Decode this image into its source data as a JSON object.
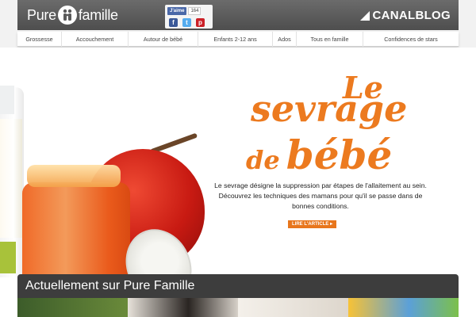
{
  "header": {
    "logo_left": "Pure",
    "logo_right": "famille",
    "brand": "CANALBLOG"
  },
  "social": {
    "like_label": "J'aime",
    "like_count": "164",
    "share_icons": [
      "facebook-icon",
      "twitter-icon",
      "pinterest-icon"
    ]
  },
  "nav": {
    "items": [
      "Grossesse",
      "Accouchement",
      "Autour de bébé",
      "Enfants 2-12 ans",
      "Ados",
      "Tous en famille",
      "Confidences de stars"
    ]
  },
  "hero": {
    "title_line1": "Le",
    "title_line2": "sevrage",
    "title_line3_prefix": "de",
    "title_line3": "bébé",
    "description": "Le sevrage désigne la suppression par étapes de l'allaitement au sein. Découvrez les techniques des mamans pour qu'il se passe dans de bonnes conditions.",
    "cta": "LIRE L'ARTICLE ▸"
  },
  "current_section": {
    "title": "Actuellement sur Pure Famille"
  },
  "colors": {
    "accent": "#ec7a1f",
    "header_bg": "#595959",
    "dark_strip": "#3d3d3d"
  }
}
